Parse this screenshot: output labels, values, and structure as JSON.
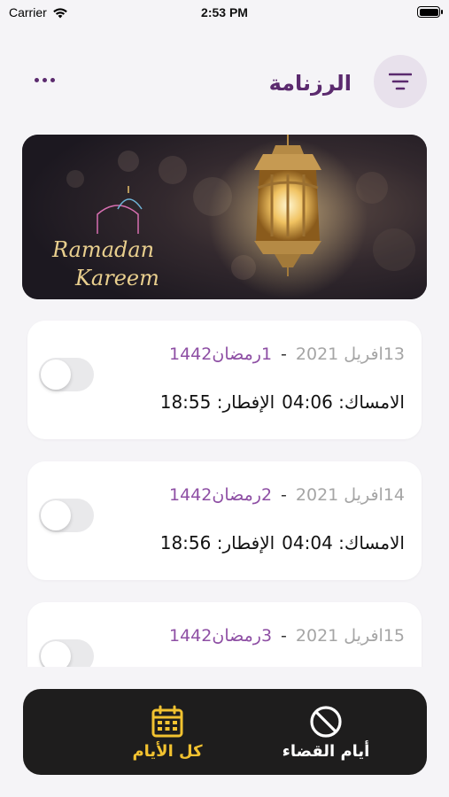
{
  "status_bar": {
    "carrier": "Carrier",
    "time": "2:53 PM",
    "battery_level": 1.0
  },
  "header": {
    "title": "الرزنامة",
    "more_icon": "more-horizontal-icon",
    "filter_icon": "filter-lines-icon"
  },
  "banner": {
    "text_line1": "Ramadan",
    "text_line2": "Kareem"
  },
  "days": [
    {
      "gregorian": "13افريل 2021",
      "dash": "-",
      "hijri": "1رمضان1442",
      "imsak_label": "الامساك:",
      "imsak_time": "04:06",
      "iftar_label": "الإفطار:",
      "iftar_time": "18:55",
      "toggle_on": false
    },
    {
      "gregorian": "14افريل 2021",
      "dash": "-",
      "hijri": "2رمضان1442",
      "imsak_label": "الامساك:",
      "imsak_time": "04:04",
      "iftar_label": "الإفطار:",
      "iftar_time": "18:56",
      "toggle_on": false
    },
    {
      "gregorian": "15افريل 2021",
      "dash": "-",
      "hijri": "3رمضان1442",
      "imsak_label": "",
      "imsak_time": "",
      "iftar_label": "",
      "iftar_time": "",
      "toggle_on": false
    }
  ],
  "bottom_nav": {
    "all_days_label": "كل الأيام",
    "qadaa_days_label": "أيام القضاء",
    "active_color": "#f2c230",
    "inactive_color": "#ffffff"
  },
  "colors": {
    "accent": "#5b2a6e",
    "hijri": "#8e4fa4",
    "background": "#f5f4f7"
  }
}
